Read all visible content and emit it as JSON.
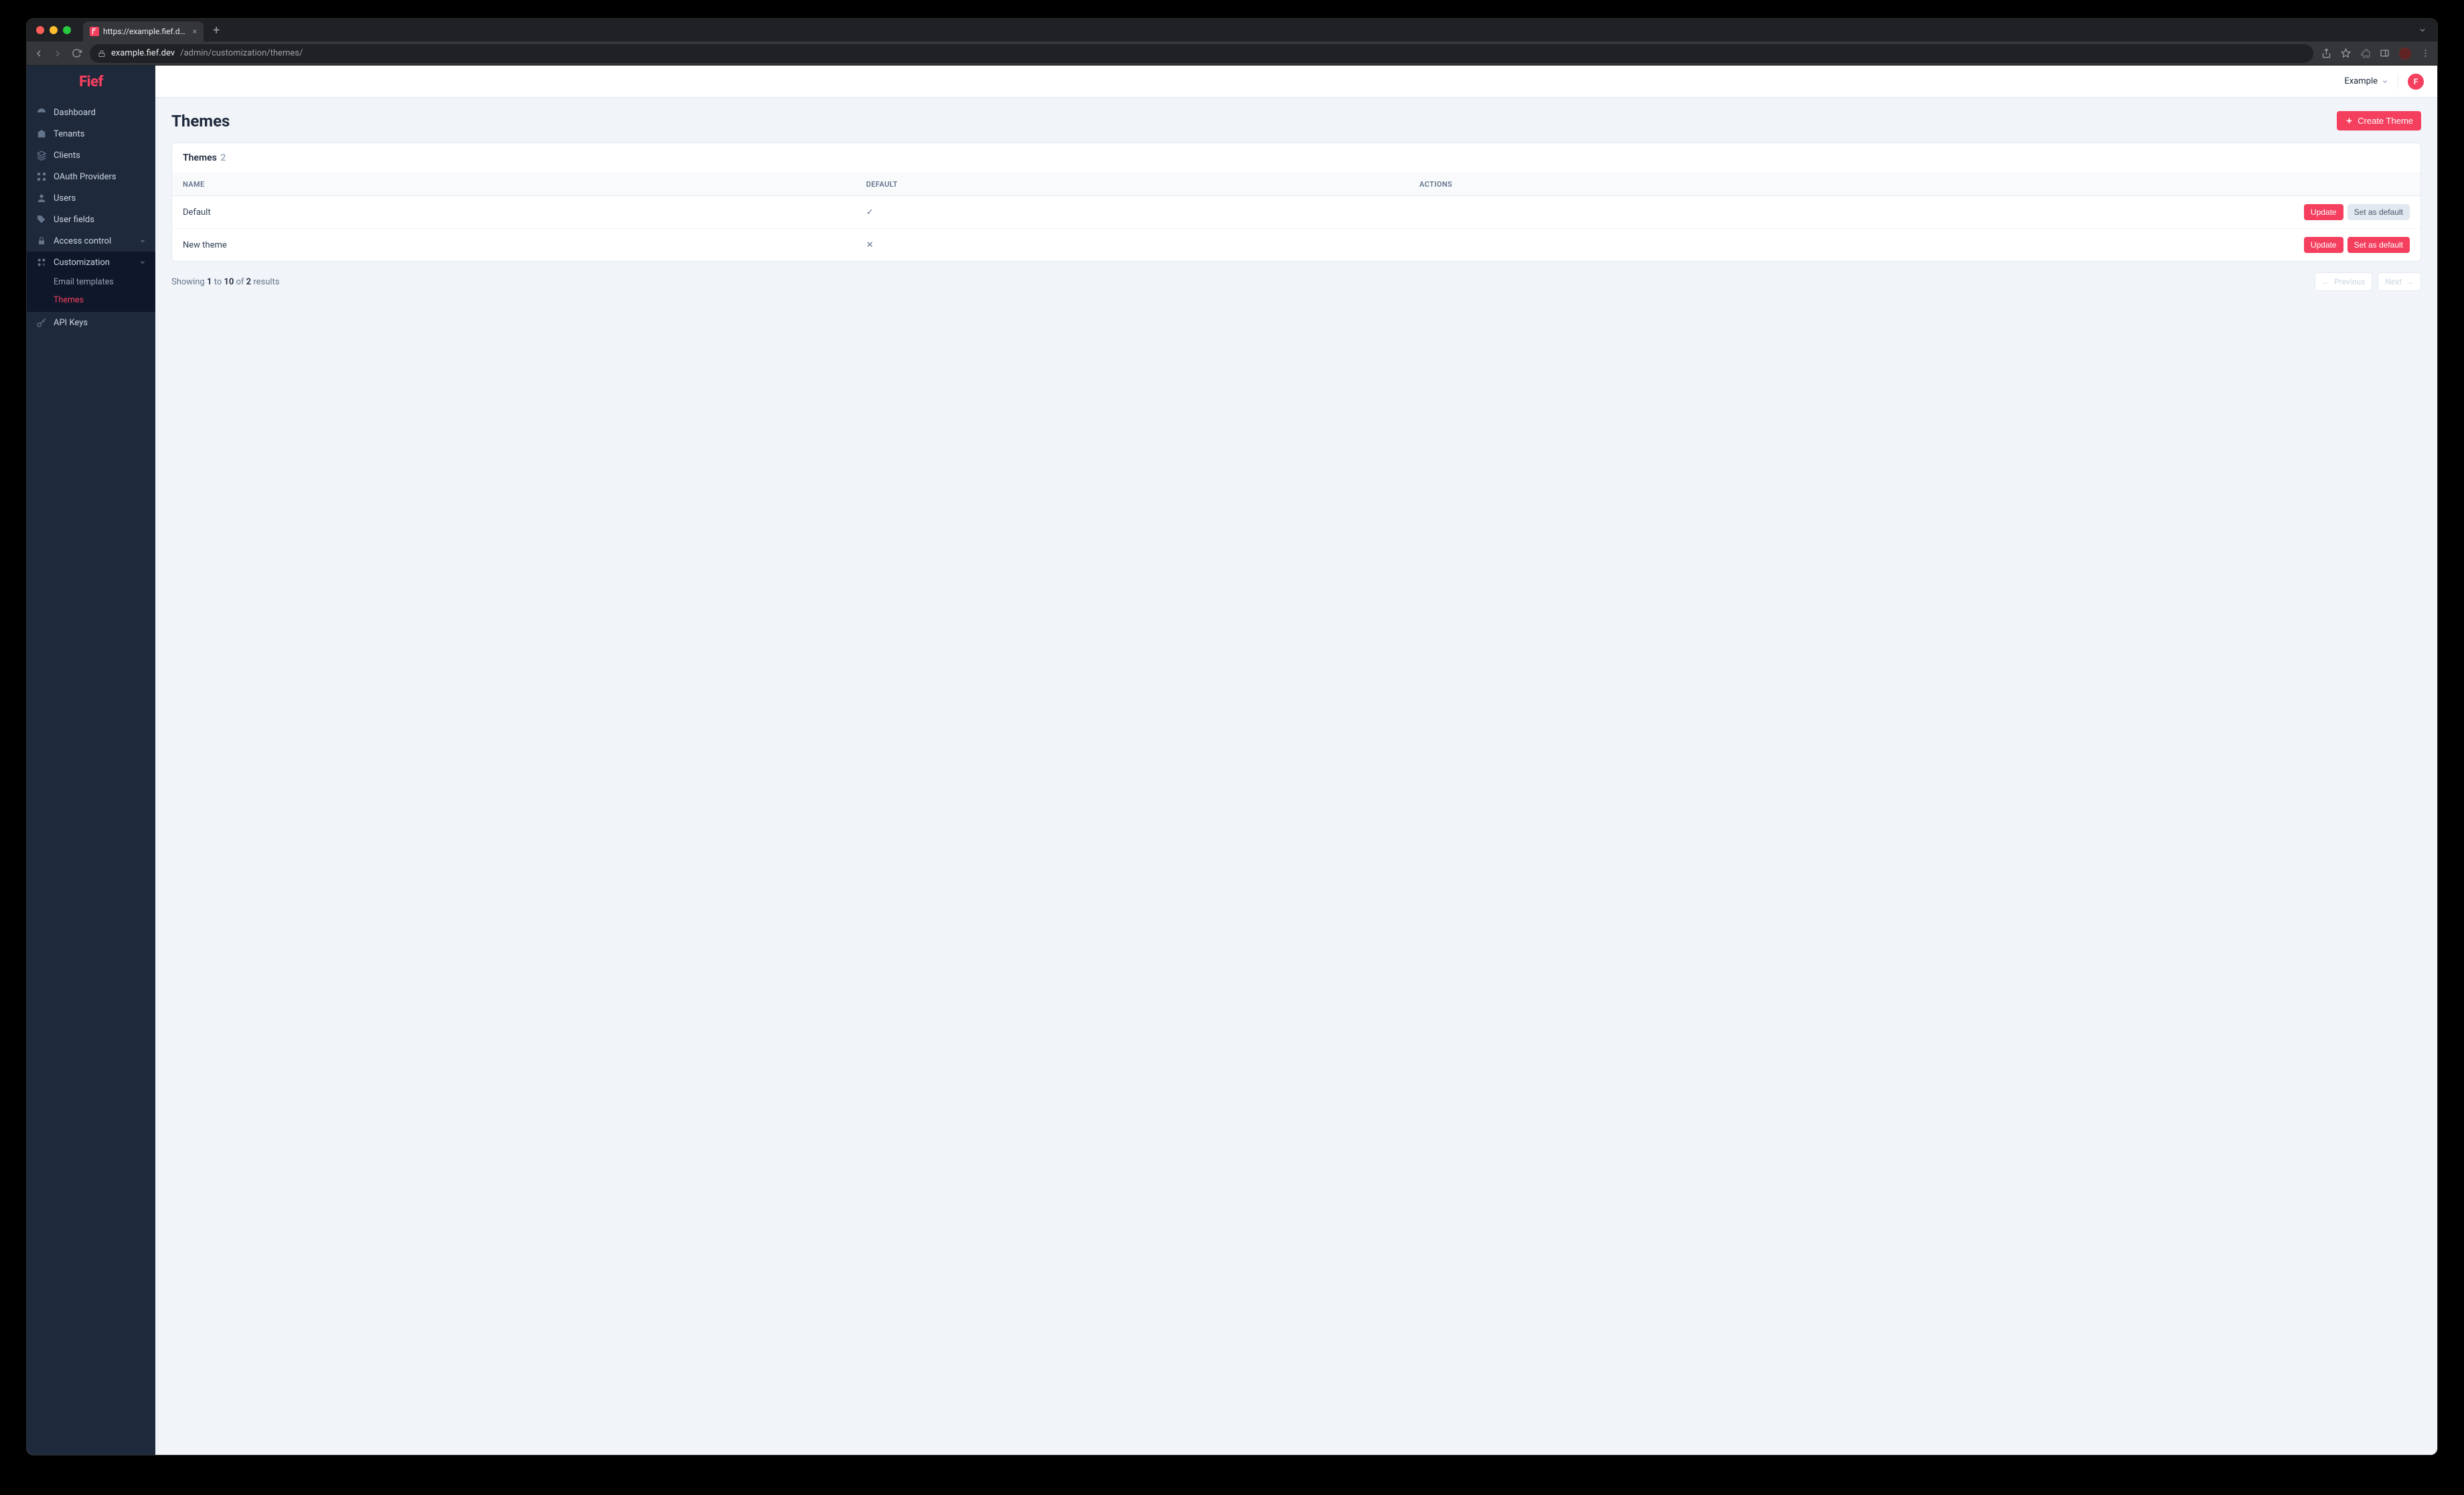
{
  "browser": {
    "tab_title": "https://example.fief.dev/admin",
    "url_host": "example.fief.dev",
    "url_path": "/admin/customization/themes/"
  },
  "brand": {
    "logo_text": "Fief"
  },
  "sidebar": {
    "items": [
      {
        "label": "Dashboard"
      },
      {
        "label": "Tenants"
      },
      {
        "label": "Clients"
      },
      {
        "label": "OAuth Providers"
      },
      {
        "label": "Users"
      },
      {
        "label": "User fields"
      },
      {
        "label": "Access control"
      },
      {
        "label": "Customization"
      },
      {
        "label": "API Keys"
      }
    ],
    "customization_children": [
      {
        "label": "Email templates",
        "active": false
      },
      {
        "label": "Themes",
        "active": true
      }
    ]
  },
  "topbar": {
    "workspace": "Example",
    "avatar_initial": "F"
  },
  "page": {
    "title": "Themes",
    "create_button": "Create Theme"
  },
  "table": {
    "title": "Themes",
    "count": "2",
    "columns": {
      "name": "NAME",
      "default": "DEFAULT",
      "actions": "ACTIONS"
    },
    "rows": [
      {
        "name": "Default",
        "default_glyph": "✓",
        "is_default": true
      },
      {
        "name": "New theme",
        "default_glyph": "✕",
        "is_default": false
      }
    ],
    "row_actions": {
      "update": "Update",
      "set_default": "Set as default"
    }
  },
  "pagination": {
    "showing": "Showing",
    "from": "1",
    "to_word": "to",
    "to": "10",
    "of_word": "of",
    "total": "2",
    "results_word": "results",
    "prev": "Previous",
    "next": "Next"
  }
}
